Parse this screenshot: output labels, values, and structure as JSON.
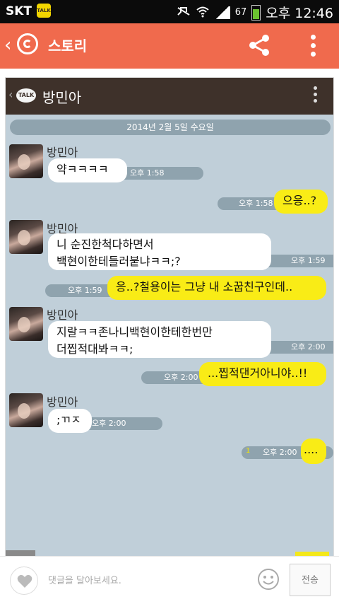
{
  "status_bar": {
    "carrier": "SKT",
    "kakao_badge": "TALK",
    "battery": "67",
    "time": "오후 12:46",
    "colors": {
      "background": "#0b0b0b",
      "battery": "#6bc230"
    }
  },
  "app_bar": {
    "title": "스토리",
    "back_icon": "chevron-left-icon",
    "logo_icon": "kakaostory-icon",
    "share_icon": "share-icon",
    "more_icon": "more-vertical-icon",
    "color": "#f06a4d"
  },
  "chat": {
    "header_title": "방민아",
    "talk_badge": "TALK",
    "date_divider": "2014년 2월 5일 수요일",
    "messages": [
      {
        "side": "left",
        "sender": "방민아",
        "text": "약ㅋㅋㅋㅋ",
        "time": "오후 1:58"
      },
      {
        "side": "right",
        "text": "으응..?",
        "time": "오후 1:58"
      },
      {
        "side": "left",
        "sender": "방민아",
        "lines": [
          "니 순진한척다하면서",
          "백현이한테들러붙냐ㅋㅋ;?"
        ],
        "time": "오후 1:59"
      },
      {
        "side": "right",
        "text": "응..?철용이는 그냥 내 소꿉친구인데..",
        "time": "오후 1:59"
      },
      {
        "side": "left",
        "sender": "방민아",
        "lines": [
          "지랄ㅋㅋ존나니백현이한테한번만",
          "더찝적대봐ㅋㅋ;"
        ],
        "time": "오후 2:00"
      },
      {
        "side": "right",
        "text": "...찝적댄거아니야..!!",
        "time": "오후 2:00"
      },
      {
        "side": "left",
        "sender": "방민아",
        "text": ";ㄲㅈ",
        "time": "오후 2:00"
      },
      {
        "side": "right",
        "text": "....",
        "time": "오후 2:00",
        "unread": "1"
      }
    ],
    "colors": {
      "background": "#c0cfd9",
      "my_bubble": "#f9ec16",
      "their_bubble": "#ffffff",
      "header": "#3e312a"
    }
  },
  "comment_bar": {
    "placeholder": "댓글을 달아보세요.",
    "send_label": "전송",
    "like_icon": "heart-icon",
    "emoji_icon": "smiley-icon"
  }
}
